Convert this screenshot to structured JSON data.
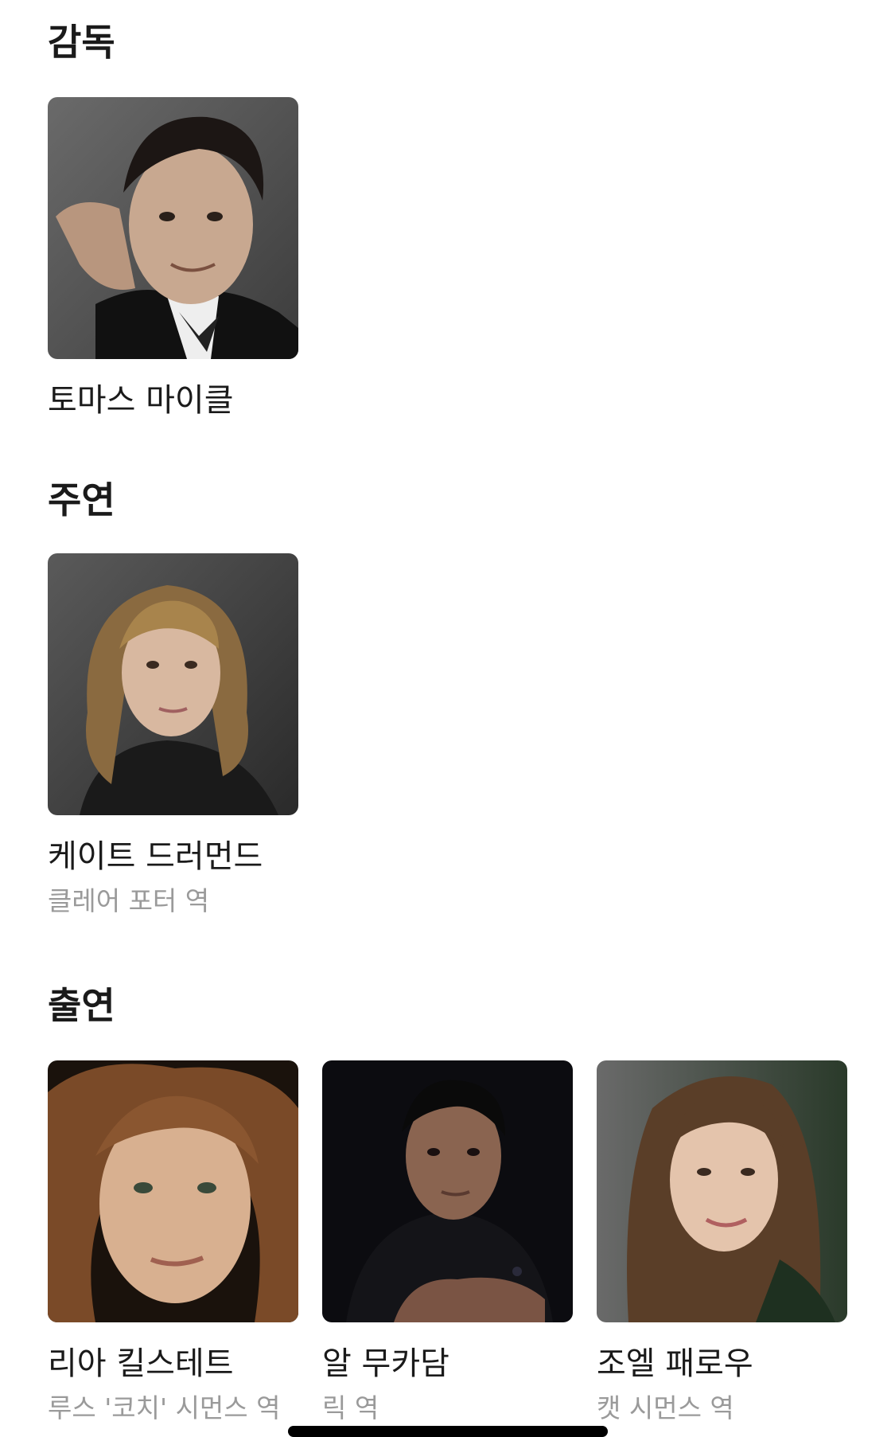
{
  "sections": {
    "director": {
      "title": "감독",
      "people": [
        {
          "name": "토마스 마이클",
          "icon": "director-portrait"
        }
      ]
    },
    "lead": {
      "title": "주연",
      "people": [
        {
          "name": "케이트 드러먼드",
          "role": "클레어 포터 역",
          "icon": "actress-portrait"
        }
      ]
    },
    "cast": {
      "title": "출연",
      "people": [
        {
          "name": "리아 킬스테트",
          "role": "루스 '코치' 시먼스 역",
          "icon": "actress-portrait"
        },
        {
          "name": "알 무카담",
          "role": "릭 역",
          "icon": "actor-portrait"
        },
        {
          "name": "조엘 패로우",
          "role": "캣 시먼스 역",
          "icon": "actress-portrait"
        }
      ]
    }
  },
  "colors": {
    "text_primary": "#1a1a1a",
    "text_secondary": "#9a9a9a",
    "background": "#ffffff"
  }
}
